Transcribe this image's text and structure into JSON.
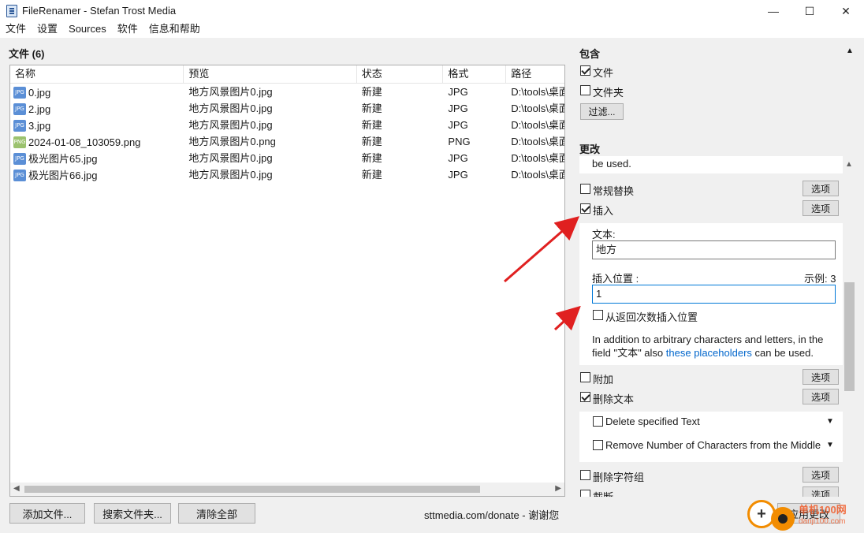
{
  "window": {
    "title": "FileRenamer - Stefan Trost Media",
    "controls": {
      "minimize": "—",
      "maximize": "☐",
      "close": "✕"
    }
  },
  "menu": [
    "文件",
    "设置",
    "Sources",
    "软件",
    "信息和帮助"
  ],
  "files_panel": {
    "heading": "文件 (6)",
    "columns": [
      "名称",
      "预览",
      "状态",
      "格式",
      "路径"
    ],
    "rows": [
      {
        "icon": "jpg-file-icon",
        "badge": "JPG",
        "name": "0.jpg",
        "preview": "地方风景图片0.jpg",
        "status": "新建",
        "format": "JPG",
        "path": "D:\\tools\\桌面"
      },
      {
        "icon": "jpg-file-icon",
        "badge": "JPG",
        "name": "2.jpg",
        "preview": "地方风景图片0.jpg",
        "status": "新建",
        "format": "JPG",
        "path": "D:\\tools\\桌面"
      },
      {
        "icon": "jpg-file-icon",
        "badge": "JPG",
        "name": "3.jpg",
        "preview": "地方风景图片0.jpg",
        "status": "新建",
        "format": "JPG",
        "path": "D:\\tools\\桌面"
      },
      {
        "icon": "png-file-icon",
        "badge": "PNG",
        "name": "2024-01-08_103059.png",
        "preview": "地方风景图片0.png",
        "status": "新建",
        "format": "PNG",
        "path": "D:\\tools\\桌面"
      },
      {
        "icon": "jpg-file-icon",
        "badge": "JPG",
        "name": "极光图片65.jpg",
        "preview": "地方风景图片0.jpg",
        "status": "新建",
        "format": "JPG",
        "path": "D:\\tools\\桌面"
      },
      {
        "icon": "jpg-file-icon",
        "badge": "JPG",
        "name": "极光图片66.jpg",
        "preview": "地方风景图片0.jpg",
        "status": "新建",
        "format": "JPG",
        "path": "D:\\tools\\桌面"
      }
    ]
  },
  "bottom_bar": {
    "add_files": "添加文件...",
    "search_folder": "搜索文件夹...",
    "clear_all": "清除全部",
    "donate": "sttmedia.com/donate - 谢谢您",
    "apply": "应用更改"
  },
  "include": {
    "heading": "包含",
    "files_label": "文件",
    "files_checked": true,
    "folders_label": "文件夹",
    "folders_checked": false,
    "filter_button": "过滤..."
  },
  "changes": {
    "heading": "更改",
    "top_text": "be used.",
    "options_label": "选项",
    "regular_replace": "常规替换",
    "insert": "插入",
    "insert_checked": true,
    "text_label": "文本:",
    "text_value": "地方",
    "position_label": "插入位置 :",
    "example_label": "示例: 3",
    "position_value": "1",
    "reverse_label": "从返回次数插入位置",
    "info_part1": "In addition to arbitrary characters and letters, in the",
    "info_part2": "field \"文本\" also",
    "info_link": "these placeholders",
    "info_part3": "can be used.",
    "append": "附加",
    "delete_text": "删除文本",
    "delete_checked": true,
    "delete_specified": "Delete specified Text",
    "remove_middle": "Remove Number of Characters from the Middle",
    "delete_char_group": "删除字符组",
    "truncate": "截断"
  },
  "watermark": {
    "text": "单机100网",
    "url": "danji100.com"
  }
}
